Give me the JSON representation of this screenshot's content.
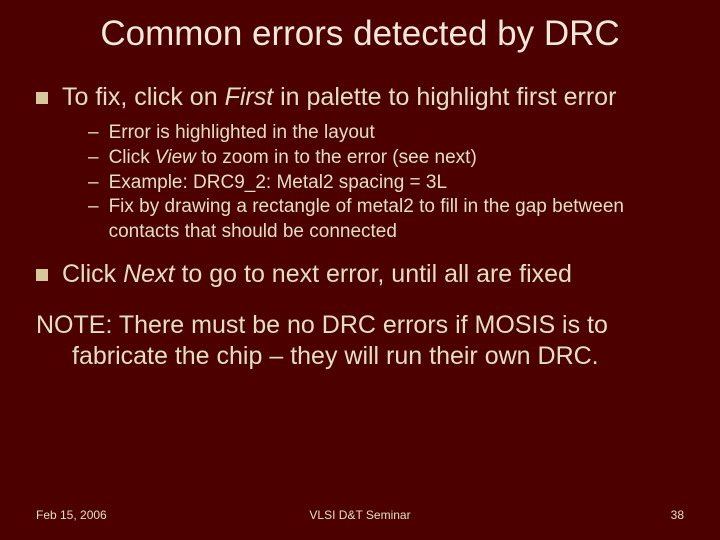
{
  "title": "Common errors detected by DRC",
  "bullets": [
    {
      "pre": "To fix, click on ",
      "italic": "First",
      "post": " in palette to highlight first error",
      "subs": [
        {
          "pre": "Error is highlighted in the layout",
          "italic": "",
          "post": ""
        },
        {
          "pre": "Click ",
          "italic": "View",
          "post": " to zoom in to the error (see next)"
        },
        {
          "pre": "Example: DRC9_2: Metal2 spacing = 3L",
          "italic": "",
          "post": ""
        },
        {
          "pre": "Fix by drawing a rectangle of metal2 to fill in the gap between contacts that should be connected",
          "italic": "",
          "post": ""
        }
      ]
    },
    {
      "pre": "Click ",
      "italic": "Next",
      "post": " to go to next error, until all are fixed",
      "subs": []
    }
  ],
  "note": "NOTE: There must be no DRC errors if MOSIS is to fabricate the chip – they will run their own DRC.",
  "footer": {
    "date": "Feb 15, 2006",
    "center": "VLSI D&T Seminar",
    "page": "38"
  }
}
